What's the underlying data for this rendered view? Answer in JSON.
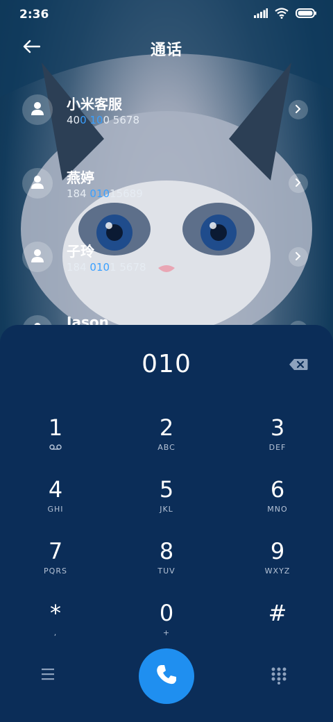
{
  "status_bar": {
    "time": "2:36"
  },
  "header": {
    "title": "通话"
  },
  "contacts": [
    {
      "name": "小米客服",
      "number_parts": [
        "40",
        "0 10",
        "0 5678"
      ]
    },
    {
      "name": "燕婷",
      "number_parts": [
        "184 ",
        "010",
        "15689"
      ]
    },
    {
      "name": "子玲",
      "number_parts": [
        "184 ",
        "010",
        "1 5678"
      ]
    },
    {
      "name": "Jason",
      "number_parts": [
        "",
        "",
        ""
      ]
    }
  ],
  "dialer": {
    "input": "010",
    "keys": [
      {
        "digit": "1",
        "letters": ""
      },
      {
        "digit": "2",
        "letters": "ABC"
      },
      {
        "digit": "3",
        "letters": "DEF"
      },
      {
        "digit": "4",
        "letters": "GHI"
      },
      {
        "digit": "5",
        "letters": "JKL"
      },
      {
        "digit": "6",
        "letters": "MNO"
      },
      {
        "digit": "7",
        "letters": "PQRS"
      },
      {
        "digit": "8",
        "letters": "TUV"
      },
      {
        "digit": "9",
        "letters": "WXYZ"
      },
      {
        "digit": "*",
        "letters": ","
      },
      {
        "digit": "0",
        "letters": "+"
      },
      {
        "digit": "#",
        "letters": ""
      }
    ]
  },
  "colors": {
    "accent": "#1f8ff0",
    "highlight": "#3aa0ff",
    "panel": "#0b2d58"
  },
  "icons": [
    "back-arrow-icon",
    "signal-icon",
    "wifi-icon",
    "battery-icon",
    "person-icon",
    "chevron-right-icon",
    "backspace-icon",
    "voicemail-icon",
    "menu-icon",
    "phone-icon",
    "dialpad-icon"
  ]
}
